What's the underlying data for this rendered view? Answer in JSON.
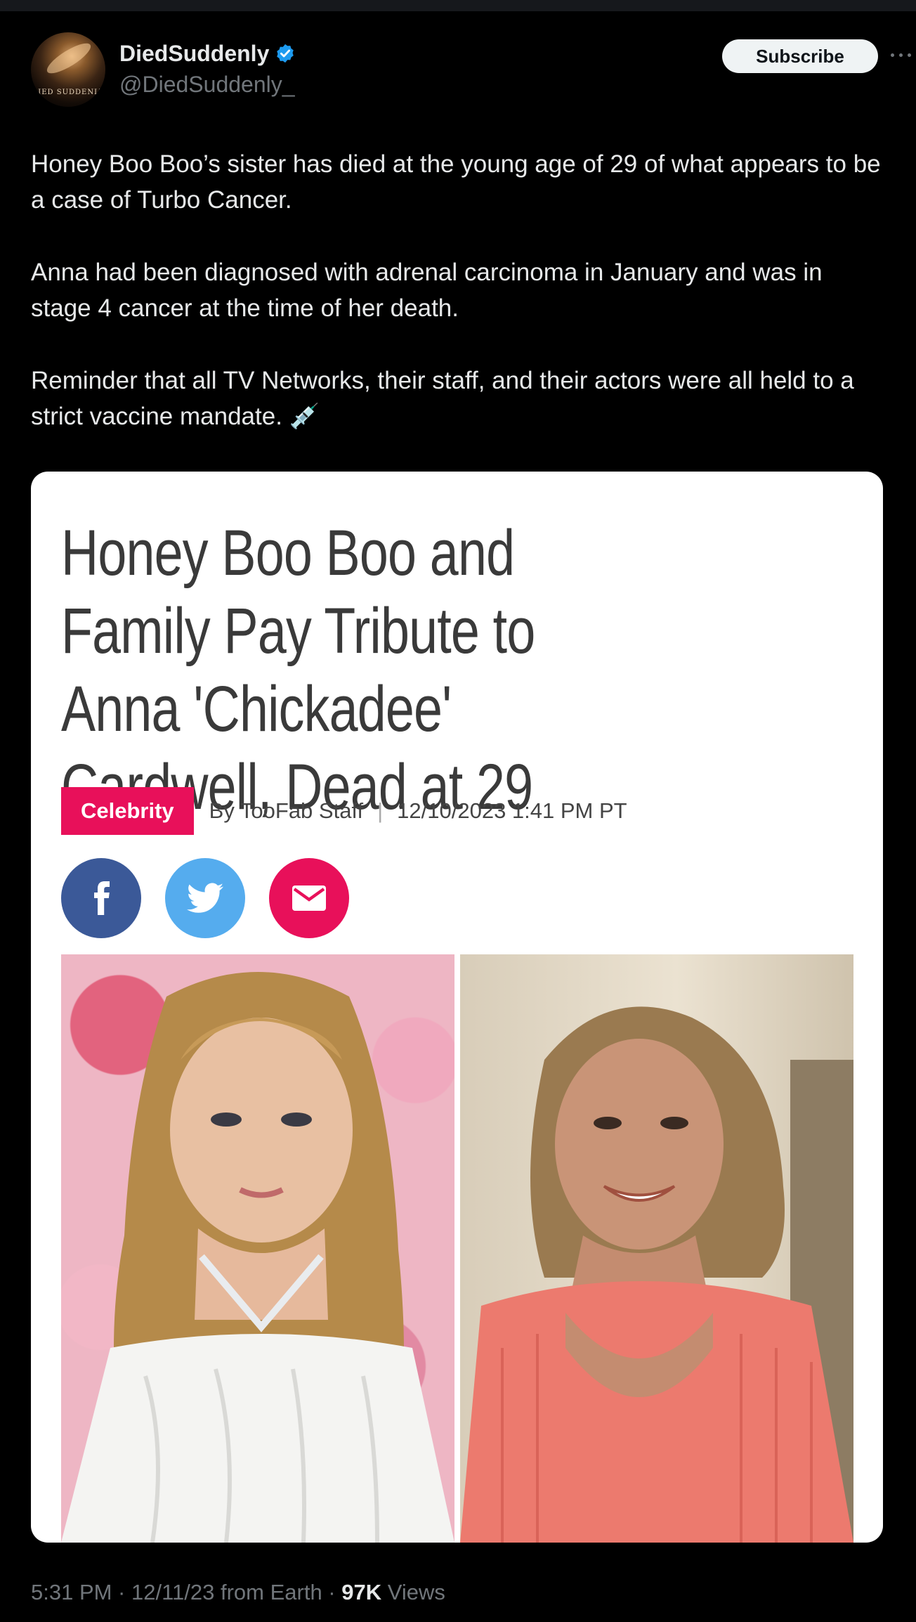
{
  "author": {
    "display_name": "DiedSuddenly",
    "handle": "@DiedSuddenly_",
    "avatar_text": "DIED SUDDENLY",
    "verified_icon": "verified-badge-icon"
  },
  "actions": {
    "subscribe_label": "Subscribe",
    "more_icon": "more-icon"
  },
  "tweet": {
    "paragraphs": [
      "Honey Boo Boo’s sister has died at the young age of 29 of what appears to be a case of Turbo Cancer.",
      "Anna had been diagnosed with adrenal carcinoma in January and was in stage 4 cancer at the time of her death.",
      "Reminder that all TV Networks, their staff, and their actors were all held to a strict vaccine mandate. 💉"
    ]
  },
  "card": {
    "headline": "Honey Boo Boo and Family Pay Tribute to Anna 'Chickadee' Cardwell, Dead at 29",
    "category": "Celebrity",
    "byline": "By TooFab Staff",
    "separator": "|",
    "date": "12/10/2023 1:41 PM PT",
    "share_icons": [
      "facebook-icon",
      "twitter-icon",
      "mail-icon"
    ]
  },
  "footer": {
    "time": "5:31 PM · 12/11/23 from Earth · ",
    "views_count": "97K",
    "views_label": " Views"
  },
  "colors": {
    "background": "#000000",
    "accent": "#1d9bf0",
    "category": "#e8105a",
    "facebook": "#3b5998",
    "twitter": "#55acee"
  }
}
